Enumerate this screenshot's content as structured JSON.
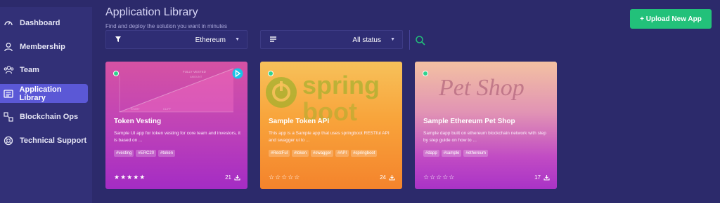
{
  "sidebar": {
    "items": [
      {
        "label": "Dashboard",
        "icon": "dashboard-icon",
        "active": false
      },
      {
        "label": "Membership",
        "icon": "user-icon",
        "active": false
      },
      {
        "label": "Team",
        "icon": "team-icon",
        "active": false
      },
      {
        "label": "Application Library",
        "icon": "library-icon",
        "active": true
      },
      {
        "label": "Blockchain Ops",
        "icon": "chain-icon",
        "active": false
      },
      {
        "label": "Technical Support",
        "icon": "support-icon",
        "active": false
      }
    ]
  },
  "header": {
    "title": "Application Library",
    "subtitle": "Find and deploy the solution you want in minutes",
    "upload_label": "+ Upload New App"
  },
  "filters": {
    "network": "Ethereum",
    "status": "All status"
  },
  "cards": [
    {
      "title": "Token Vesting",
      "description": "Sample UI app for token vesting for core team and investors, it is based on ...",
      "tags": [
        "#vesting",
        "#ERC20",
        "#token"
      ],
      "rating": "★★★★★",
      "downloads": "21",
      "art_text_1": "FULLY VESTED",
      "art_text_2": "AMOUNT",
      "art_text_3": "CLIFF",
      "art_text_4": "START"
    },
    {
      "title": "Sample Token API",
      "description": "This app is a Sample app that uses springboot RESTful API and swagger ui to ...",
      "tags": [
        "#RestFul",
        "#token",
        "#swagger",
        "#API",
        "#springboot"
      ],
      "rating": "☆☆☆☆☆",
      "downloads": "24",
      "art_text_1": "spring",
      "art_text_2": "boot"
    },
    {
      "title": "Sample Ethereum Pet Shop",
      "description": "Sample dapp built on ethereum blockchain network with step by step guide on how to ...",
      "tags": [
        "#dapp",
        "#sample",
        "#ethereum"
      ],
      "rating": "☆☆☆☆☆",
      "downloads": "17",
      "art_text_1": "Pet Shop"
    }
  ],
  "colors": {
    "background": "#2c2a6b",
    "sidebar": "#323077",
    "active": "#5b58d6",
    "accent": "#22c17a"
  }
}
